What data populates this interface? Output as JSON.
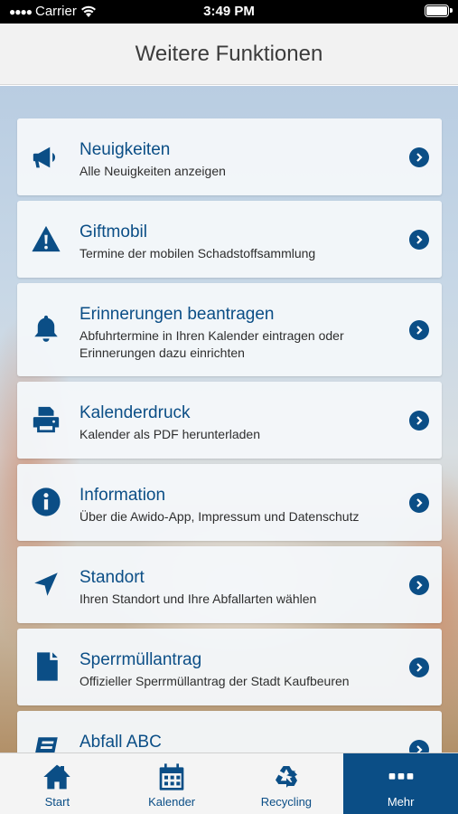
{
  "status_bar": {
    "carrier": "Carrier",
    "time": "3:49 PM"
  },
  "header": {
    "title": "Weitere Funktionen"
  },
  "items": [
    {
      "title": "Neuigkeiten",
      "subtitle": "Alle Neuigkeiten anzeigen",
      "icon": "megaphone-icon"
    },
    {
      "title": "Giftmobil",
      "subtitle": "Termine der mobilen Schadstoffsammlung",
      "icon": "warning-icon"
    },
    {
      "title": "Erinnerungen beantragen",
      "subtitle": "Abfuhrtermine in Ihren Kalender eintragen oder Erinnerungen dazu einrichten",
      "icon": "bell-icon"
    },
    {
      "title": "Kalenderdruck",
      "subtitle": "Kalender als PDF herunterladen",
      "icon": "printer-icon"
    },
    {
      "title": "Information",
      "subtitle": "Über die Awido-App, Impressum und Datenschutz",
      "icon": "info-icon"
    },
    {
      "title": "Standort",
      "subtitle": "Ihren Standort und Ihre Abfallarten wählen",
      "icon": "location-arrow-icon"
    },
    {
      "title": "Sperrmüllantrag",
      "subtitle": "Offizieller Sperrmüllantrag der Stadt Kaufbeuren",
      "icon": "document-icon"
    },
    {
      "title": "Abfall ABC",
      "subtitle": "",
      "icon": "book-icon"
    }
  ],
  "tabbar": {
    "tabs": [
      {
        "label": "Start",
        "icon": "home-icon"
      },
      {
        "label": "Kalender",
        "icon": "calendar-icon"
      },
      {
        "label": "Recycling",
        "icon": "recycle-icon"
      },
      {
        "label": "Mehr",
        "icon": "more-icon"
      }
    ],
    "active": "Mehr"
  },
  "colors": {
    "accent": "#0b4e86",
    "header_bg": "#f2f2f2",
    "tabbar_bg": "#f4f4f4"
  }
}
